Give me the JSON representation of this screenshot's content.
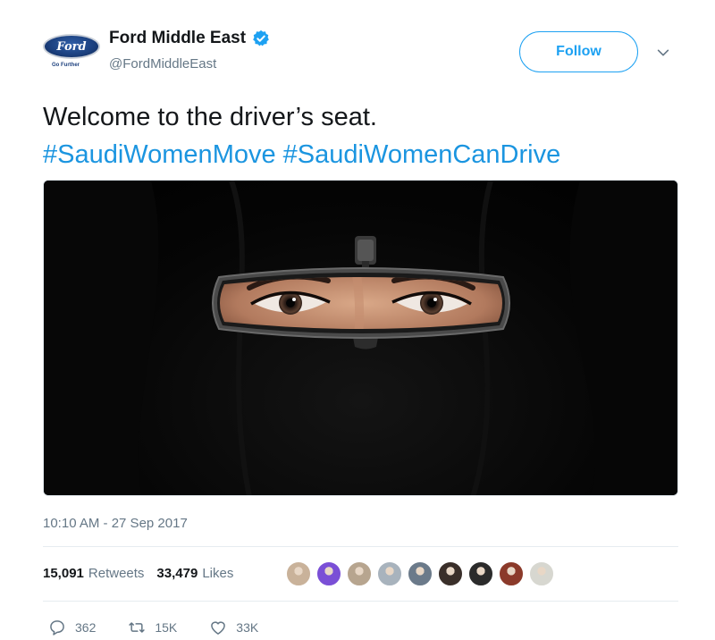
{
  "account": {
    "logo_text": "Ford",
    "logo_tagline": "Go Further",
    "display_name": "Ford Middle East",
    "handle": "@FordMiddleEast",
    "follow_label": "Follow"
  },
  "tweet": {
    "text": "Welcome to the driver’s seat.",
    "hashtags": [
      "#SaudiWomenMove",
      "#SaudiWomenCanDrive"
    ],
    "timestamp": "10:10 AM - 27 Sep 2017"
  },
  "stats": {
    "retweets_count": "15,091",
    "retweets_label": "Retweets",
    "likes_count": "33,479",
    "likes_label": "Likes"
  },
  "avatars": [
    {
      "icon": "avatar-1",
      "color": "#c9b29a"
    },
    {
      "icon": "avatar-2",
      "color": "#7a4fd6"
    },
    {
      "icon": "avatar-3",
      "color": "#b7a58f"
    },
    {
      "icon": "avatar-4",
      "color": "#a8b3bd"
    },
    {
      "icon": "avatar-5",
      "color": "#6b7a8a"
    },
    {
      "icon": "avatar-6",
      "color": "#3a2f2a"
    },
    {
      "icon": "avatar-7",
      "color": "#2b2b2b"
    },
    {
      "icon": "avatar-8",
      "color": "#8b3a2a"
    },
    {
      "icon": "avatar-9",
      "color": "#d7d7d0"
    }
  ],
  "actions": {
    "replies": "362",
    "retweets": "15K",
    "likes": "33K"
  },
  "colors": {
    "accent": "#1da1f2",
    "hashtag": "#1b95e0",
    "muted": "#657786"
  }
}
